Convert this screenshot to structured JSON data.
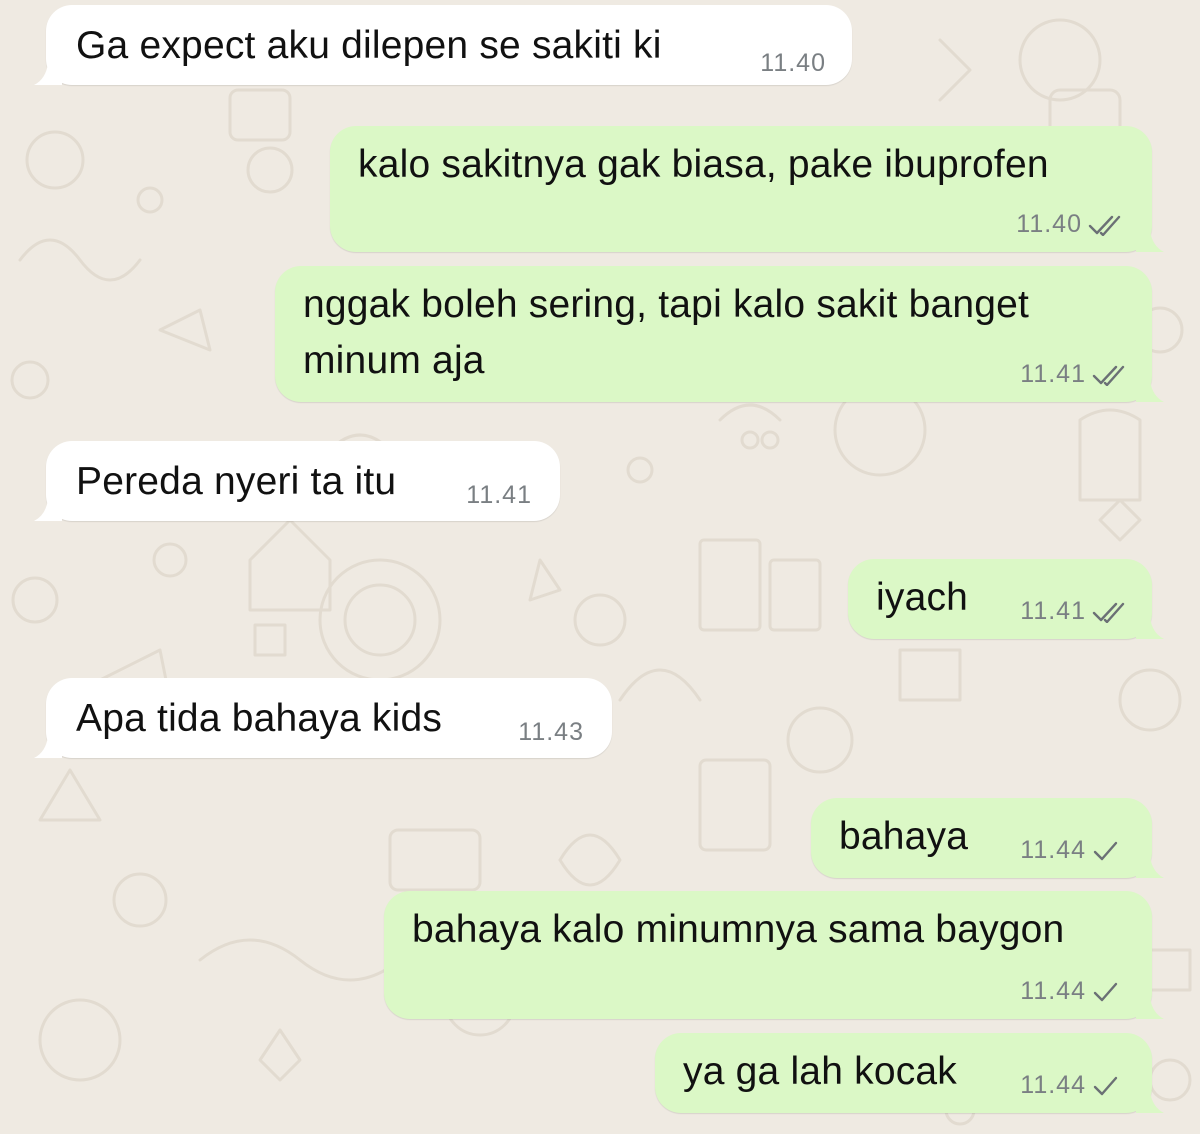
{
  "chat": {
    "messages": [
      {
        "side": "in",
        "text": "Ga expect aku dilepen se sakiti ki",
        "time": "11.40",
        "status": null
      },
      {
        "side": "out",
        "text": "kalo sakitnya gak biasa, pake ibuprofen",
        "time": "11.40",
        "status": "read"
      },
      {
        "side": "out",
        "line1": "nggak boleh sering, tapi kalo sakit banget",
        "line2": "minum aja",
        "time": "11.41",
        "status": "read"
      },
      {
        "side": "in",
        "text": "Pereda nyeri ta itu",
        "time": "11.41",
        "status": null
      },
      {
        "side": "out",
        "text": "iyach",
        "time": "11.41",
        "status": "read"
      },
      {
        "side": "in",
        "text": "Apa tida bahaya kids",
        "time": "11.43",
        "status": null
      },
      {
        "side": "out",
        "text": "bahaya",
        "time": "11.44",
        "status": "sent"
      },
      {
        "side": "out",
        "text": "bahaya kalo minumnya sama baygon",
        "time": "11.44",
        "status": "sent"
      },
      {
        "side": "out",
        "text": "ya ga lah kocak",
        "time": "11.44",
        "status": "sent"
      }
    ]
  },
  "colors": {
    "background": "#efeae2",
    "incoming_bubble": "#ffffff",
    "outgoing_bubble": "#dbf8c6",
    "text": "#111111",
    "meta": "#7a7f83"
  },
  "icons": {
    "read": "double-check-icon",
    "sent": "single-check-icon"
  }
}
